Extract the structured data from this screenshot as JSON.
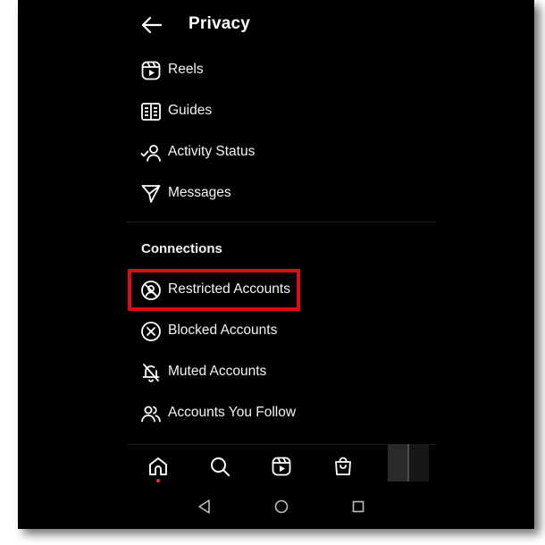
{
  "header": {
    "title": "Privacy",
    "back_icon": "arrow-left-icon"
  },
  "items_top": [
    {
      "label": "Reels",
      "icon": "reels-icon"
    },
    {
      "label": "Guides",
      "icon": "guides-icon"
    },
    {
      "label": "Activity Status",
      "icon": "activity-status-icon"
    },
    {
      "label": "Messages",
      "icon": "messages-icon"
    }
  ],
  "connections": {
    "section_label": "Connections",
    "items": [
      {
        "label": "Restricted Accounts",
        "icon": "restricted-icon"
      },
      {
        "label": "Blocked Accounts",
        "icon": "blocked-icon"
      },
      {
        "label": "Muted Accounts",
        "icon": "muted-bell-icon"
      },
      {
        "label": "Accounts You Follow",
        "icon": "people-icon"
      }
    ]
  },
  "bottom_nav": {
    "items": [
      "home-icon",
      "search-icon",
      "reels-icon",
      "shop-icon",
      "profile-avatar"
    ]
  },
  "system_nav": [
    "back-triangle-icon",
    "home-circle-icon",
    "recents-square-icon"
  ],
  "colors": {
    "background": "#000000",
    "text": "#ffffff",
    "highlight_border": "#e00a14",
    "notification_dot": "#ff3040"
  }
}
